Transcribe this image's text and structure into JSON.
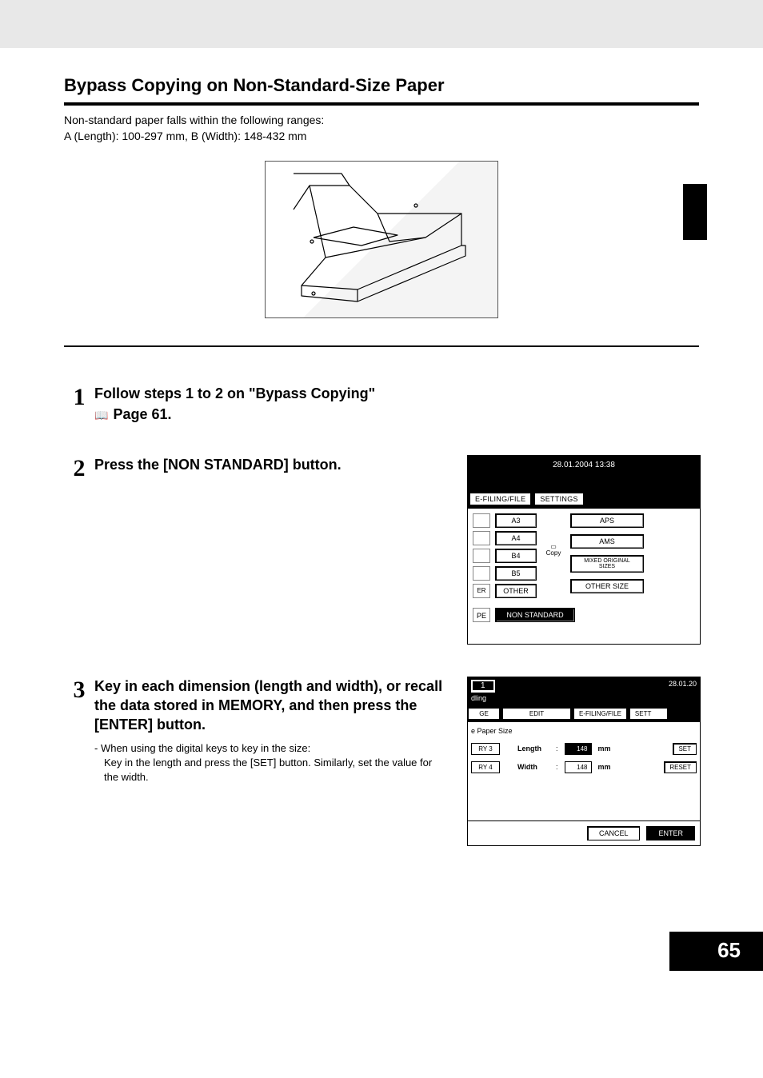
{
  "header": {
    "title": "Bypass Copying on Non-Standard-Size Paper"
  },
  "intro": {
    "line1": "Non-standard paper falls within the following ranges:",
    "line2": "A (Length): 100-297 mm, B (Width): 148-432 mm"
  },
  "steps": {
    "s1": {
      "num": "1",
      "title": "Follow steps 1 to 2 on \"Bypass Copying\"",
      "ref": "Page 61."
    },
    "s2": {
      "num": "2",
      "title": "Press the [NON STANDARD] button."
    },
    "s3": {
      "num": "3",
      "title": "Key in each dimension (length and width), or recall the data stored in MEMORY, and then press the [ENTER] button.",
      "note_lead": "- When using the digital keys to key in the size:",
      "note_line1": "Key in the length and press the [SET] button. Similarly, set the value for the width."
    }
  },
  "screen1": {
    "datetime": "28.01.2004 13:38",
    "tab_efiling": "E-FILING/FILE",
    "tab_settings": "SETTINGS",
    "sizes": {
      "a3": "A3",
      "a4": "A4",
      "b4": "B4",
      "b5": "B5",
      "other": "OTHER"
    },
    "copy_label": "Copy",
    "right": {
      "aps": "APS",
      "ams": "AMS",
      "mixed": "MIXED ORIGINAL SIZES",
      "other_size": "OTHER SIZE"
    },
    "left_er": "ER",
    "pe_label": "PE",
    "non_standard": "NON STANDARD"
  },
  "screen2": {
    "count": "1",
    "dling": "dling",
    "date_frag": "28.01.20",
    "tabs": {
      "ge": "GE",
      "edit": "EDIT",
      "efiling": "E-FILING/FILE",
      "sett": "SETT"
    },
    "body_label": "e Paper Size",
    "tray3": "RY 3",
    "tray4": "RY 4",
    "length_label": "Length",
    "width_label": "Width",
    "length_val_prefix": ":",
    "length_val": "148",
    "width_val_prefix": ":",
    "width_val": "148",
    "mm": "mm",
    "set": "SET",
    "reset": "RESET",
    "cancel": "CANCEL",
    "enter": "ENTER"
  },
  "page_number": "65"
}
